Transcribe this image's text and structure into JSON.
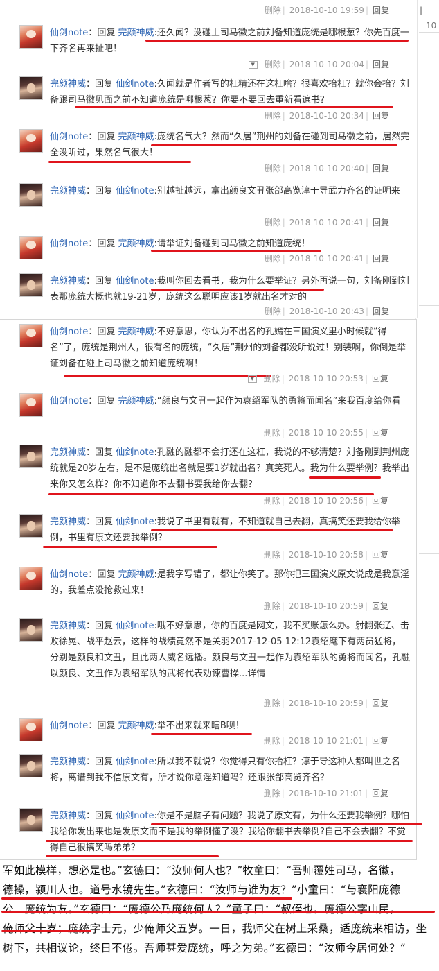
{
  "edge": {
    "mark": "|",
    "mark2": "10"
  },
  "footer": {
    "delete": "删除",
    "reply": "回复",
    "sep": "|"
  },
  "first_footer_time": "2018-10-10 19:59",
  "comments": [
    {
      "avatar": "red",
      "author": "仙剑note",
      "connector": ":",
      "reply_word": "回复",
      "target": "完颜神威",
      "text": "还久闻？没碰上司马徽之前刘备知道庞统是哪根葱？你先百度一下齐名再来扯吧！",
      "time": "2018-10-10 20:04",
      "dropdown": true
    },
    {
      "avatar": "dark",
      "author": "完颜神威",
      "connector": ":",
      "reply_word": "回复",
      "target": "仙剑note",
      "text": "久闻就是作者写的杠精还在这杠啥？很喜欢抬杠？就你会抬？刘备跟司马徽见面之前不知道庞统是哪根葱？你要不要回去重新看遍书？",
      "time": "2018-10-10 20:34"
    },
    {
      "avatar": "red",
      "author": "仙剑note",
      "connector": ":",
      "reply_word": "回复",
      "target": "完颜神威",
      "text": "庞统名气大？然而“久居”荆州的刘备在碰到司马徽之前，居然完全没听过，果然名气很大！",
      "time": "2018-10-10 20:40"
    },
    {
      "avatar": "dark",
      "author": "完颜神威",
      "connector": ":",
      "reply_word": "回复",
      "target": "仙剑note",
      "text": "别越扯越远，拿出颜良文丑张郃高览淳于导武力齐名的证明来",
      "time": "2018-10-10 20:41"
    },
    {
      "avatar": "red",
      "author": "仙剑note",
      "connector": ":",
      "reply_word": "回复",
      "target": "完颜神威",
      "text": "请举证刘备碰到司马徽之前知道庞统！",
      "time": "2018-10-10 20:41"
    },
    {
      "avatar": "dark",
      "author": "完颜神威",
      "connector": ":",
      "reply_word": "回复",
      "target": "仙剑note",
      "text": "我叫你回去看书，我为什么要举证？另外再说一句，刘备刚到刘表那庞统大概也就19-21岁，庞统这么聪明应该1岁就出名才对的",
      "time": "2018-10-10 20:43"
    },
    {
      "avatar": "red",
      "author": "仙剑note",
      "connector": ":",
      "reply_word": "回复",
      "target": "完颜神威",
      "text": "不好意思，你认为不出名的孔嫣在三国演义里小时候就“得名”了，庞统是荆州人，很有名的庞统，“久居”荆州的刘备都没听说过！别装啊，你倒是举证刘备在碰上司马徽之前知道庞统啊！",
      "time": "2018-10-10 20:53",
      "dropdown": true
    },
    {
      "avatar": "red",
      "author": "仙剑note",
      "connector": ":",
      "reply_word": "回复",
      "target": "完颜神威",
      "text": "“颜良与文丑一起作为袁绍军队的勇将而闻名”来我百度给你看",
      "time": "2018-10-10 20:55"
    },
    {
      "avatar": "dark",
      "author": "完颜神威",
      "connector": ":",
      "reply_word": "回复",
      "target": "仙剑note",
      "text": "孔融的融都不会打还在这杠，我说的不够清楚？刘备刚到荆州庞统就是20岁左右，是不是庞统出名就是要1岁就出名？真笑死人。我为什么要举例？我举出来你又怎么样？你不知道你不去翻书要我给你去翻？",
      "time": "2018-10-10 20:56"
    },
    {
      "avatar": "dark",
      "author": "完颜神威",
      "connector": ":",
      "reply_word": "回复",
      "target": "仙剑note",
      "text": "我说了书里有就有，不知道就自己去翻，真搞笑还要我给你举例，书里有原文还要我举例？",
      "time": "2018-10-10 20:58"
    },
    {
      "avatar": "red",
      "author": "仙剑note",
      "connector": ":",
      "reply_word": "回复",
      "target": "完颜神威",
      "text": "是我字写错了，都让你笑了。那你把三国演义原文说成是我意淫的，我差点没抢救过来！",
      "time": "2018-10-10 20:59"
    },
    {
      "avatar": "dark",
      "author": "完颜神威",
      "connector": ":",
      "reply_word": "回复",
      "target": "仙剑note",
      "text": "哦不好意思，你的百度是网文，我不买账怎么办。射翻张辽、击败徐晃、战平赵云，这样的战绩竟然不是关羽2017-12-05 12:12袁绍麾下有两员猛将，分别是颜良和文丑，且此两人威名远播。颜良与文丑一起作为袁绍军队的勇将而闻名，孔融以颜良、文丑作为袁绍军队的武将代表劝谏曹操...详情",
      "time": "2018-10-10 20:59"
    },
    {
      "avatar": "red",
      "author": "仙剑note",
      "connector": ":",
      "reply_word": "回复",
      "target": "完颜神威",
      "text": "举不出来就来瞎B呗！",
      "time": "2018-10-10 21:01"
    },
    {
      "avatar": "dark",
      "author": "完颜神威",
      "connector": ":",
      "reply_word": "回复",
      "target": "仙剑note",
      "text": "所以我不就说？你觉得只有你抬杠？淳于导这种人都叫世之名将，离谱到我不信原文有，所才说你意淫知道吗？还跟张郃高览齐名？",
      "time": "2018-10-10 21:01"
    },
    {
      "avatar": "dark",
      "author": "完颜神威",
      "connector": ":",
      "reply_word": "回复",
      "target": "仙剑note",
      "text": "你是不是脑子有问题？我说了原文有，为什么还要我举例？哪怕我给你发出来也是发原文而不是我的举例懂了没？我给你翻书去举例?自己不会去翻？不觉得自己很搞笑吗弟弟？"
    }
  ],
  "book": {
    "lines": [
      "军如此模样，想必是也。”玄德曰：“汝师何人也？”牧童曰：“吾师覆姓司马，名徽，",
      "德操，颍川人也。道号水镜先生。”玄德曰：“汝师与谁为友？”小童曰：“与襄阳庞德",
      "公、庞统为友。”玄德曰：“庞德公乃庞统何人？”童子曰：“叔侄也。庞德公字山民，",
      "俺师父十岁；庞统字士元，少俺师父五岁。一日，我师父在树上采桑，适庞统来相访，坐",
      "树下，共相议论，终日不倦。吾师甚爱庞统，呼之为弟。”玄德曰：“汝师今居何处？”"
    ]
  }
}
